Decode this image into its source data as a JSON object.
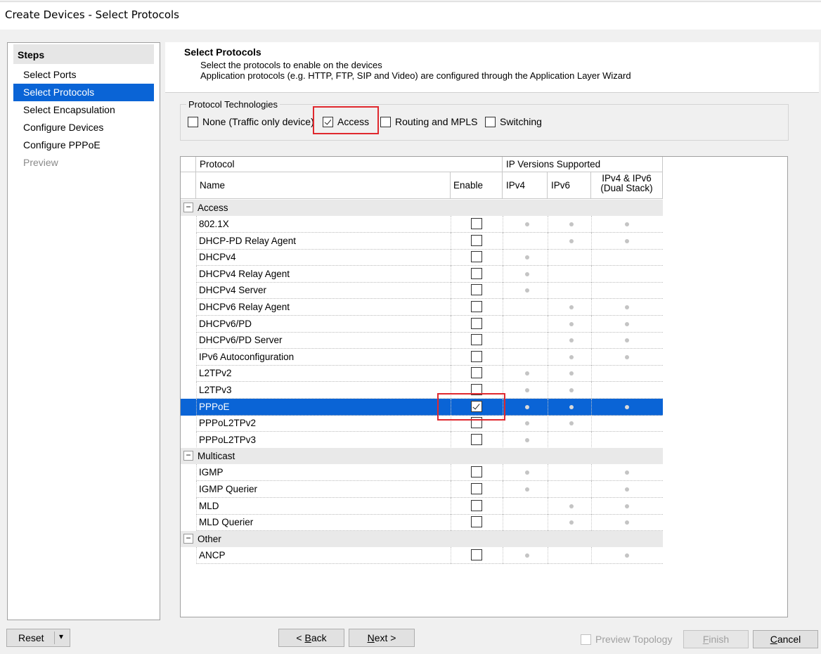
{
  "window": {
    "title": "Create Devices - Select Protocols"
  },
  "steps": {
    "header": "Steps",
    "items": [
      {
        "label": "Select Ports",
        "state": "normal"
      },
      {
        "label": "Select Protocols",
        "state": "active"
      },
      {
        "label": "Select Encapsulation",
        "state": "normal"
      },
      {
        "label": "Configure Devices",
        "state": "normal"
      },
      {
        "label": "Configure PPPoE",
        "state": "normal"
      },
      {
        "label": "Preview",
        "state": "disabled"
      }
    ]
  },
  "page": {
    "title": "Select Protocols",
    "line1": "Select the protocols to enable on the devices",
    "line2": "Application protocols (e.g. HTTP, FTP, SIP and Video) are configured through the Application Layer Wizard"
  },
  "tech": {
    "label": "Protocol Technologies",
    "options": [
      {
        "label": "None (Traffic only device)",
        "checked": false
      },
      {
        "label": "Access",
        "checked": true
      },
      {
        "label": "Routing and MPLS",
        "checked": false
      },
      {
        "label": "Switching",
        "checked": false
      }
    ]
  },
  "grid": {
    "header_protocol": "Protocol",
    "header_ip": "IP Versions Supported",
    "col_name": "Name",
    "col_enable": "Enable",
    "col_ipv4": "IPv4",
    "col_ipv6": "IPv6",
    "col_dual_1": "IPv4 & IPv6",
    "col_dual_2": "(Dual Stack)",
    "toggle_symbol": "−",
    "groups": [
      {
        "name": "Access",
        "rows": [
          {
            "name": "802.1X",
            "enabled": false,
            "ipv4": true,
            "ipv6": true,
            "dual": true
          },
          {
            "name": "DHCP-PD Relay Agent",
            "enabled": false,
            "ipv4": false,
            "ipv6": true,
            "dual": true
          },
          {
            "name": "DHCPv4",
            "enabled": false,
            "ipv4": true,
            "ipv6": false,
            "dual": false
          },
          {
            "name": "DHCPv4 Relay Agent",
            "enabled": false,
            "ipv4": true,
            "ipv6": false,
            "dual": false
          },
          {
            "name": "DHCPv4 Server",
            "enabled": false,
            "ipv4": true,
            "ipv6": false,
            "dual": false
          },
          {
            "name": "DHCPv6 Relay Agent",
            "enabled": false,
            "ipv4": false,
            "ipv6": true,
            "dual": true
          },
          {
            "name": "DHCPv6/PD",
            "enabled": false,
            "ipv4": false,
            "ipv6": true,
            "dual": true
          },
          {
            "name": "DHCPv6/PD Server",
            "enabled": false,
            "ipv4": false,
            "ipv6": true,
            "dual": true
          },
          {
            "name": "IPv6 Autoconfiguration",
            "enabled": false,
            "ipv4": false,
            "ipv6": true,
            "dual": true
          },
          {
            "name": "L2TPv2",
            "enabled": false,
            "ipv4": true,
            "ipv6": true,
            "dual": false
          },
          {
            "name": "L2TPv3",
            "enabled": false,
            "ipv4": true,
            "ipv6": true,
            "dual": false
          },
          {
            "name": "PPPoE",
            "enabled": true,
            "selected": true,
            "ipv4": true,
            "ipv6": true,
            "dual": true
          },
          {
            "name": "PPPoL2TPv2",
            "enabled": false,
            "ipv4": true,
            "ipv6": true,
            "dual": false
          },
          {
            "name": "PPPoL2TPv3",
            "enabled": false,
            "ipv4": true,
            "ipv6": false,
            "dual": false
          }
        ]
      },
      {
        "name": "Multicast",
        "rows": [
          {
            "name": "IGMP",
            "enabled": false,
            "ipv4": true,
            "ipv6": false,
            "dual": true
          },
          {
            "name": "IGMP Querier",
            "enabled": false,
            "ipv4": true,
            "ipv6": false,
            "dual": true
          },
          {
            "name": "MLD",
            "enabled": false,
            "ipv4": false,
            "ipv6": true,
            "dual": true
          },
          {
            "name": "MLD Querier",
            "enabled": false,
            "ipv4": false,
            "ipv6": true,
            "dual": true
          }
        ]
      },
      {
        "name": "Other",
        "rows": [
          {
            "name": "ANCP",
            "enabled": false,
            "ipv4": true,
            "ipv6": false,
            "dual": true
          }
        ]
      }
    ]
  },
  "footer": {
    "reset": "Reset",
    "reset_arrow": "▾",
    "back_prefix": "< ",
    "back_u": "B",
    "back_rest": "ack",
    "next_u": "N",
    "next_rest": "ext >",
    "preview_topology": "Preview Topology",
    "finish_u": "F",
    "finish_rest": "inish",
    "cancel_u": "C",
    "cancel_rest": "ancel"
  },
  "colors": {
    "selection": "#0a64d6",
    "highlight_box": "#e0282e"
  }
}
